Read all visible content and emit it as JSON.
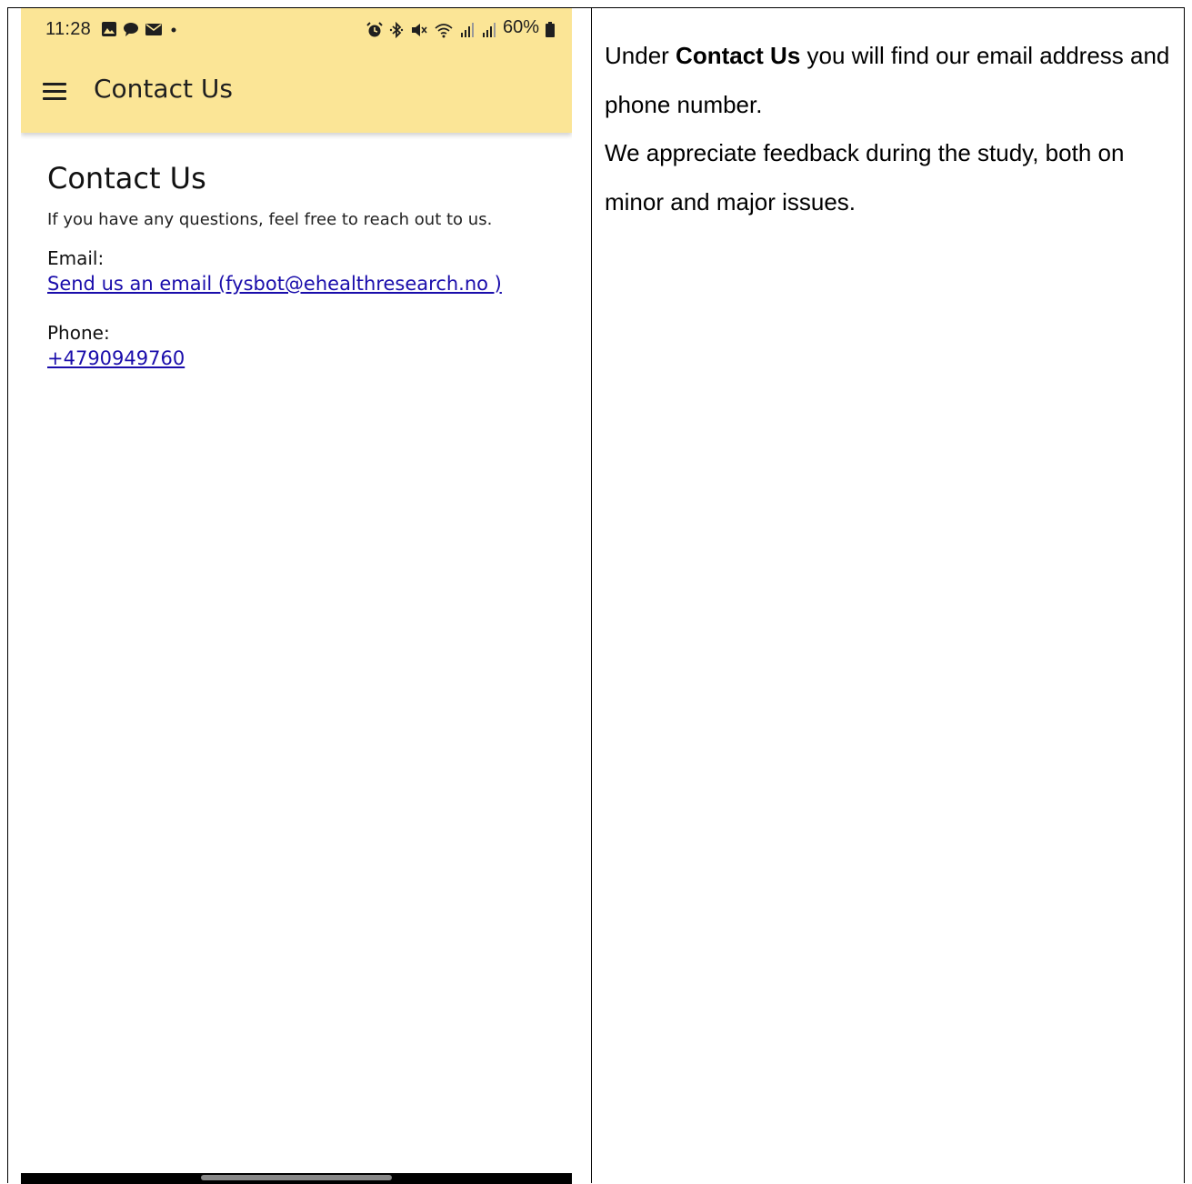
{
  "status_bar": {
    "time": "11:28",
    "battery": "60%",
    "left_icons": [
      "gallery-icon",
      "chat-icon",
      "mail-icon",
      "dot-icon"
    ],
    "right_icons": [
      "alarm-icon",
      "bluetooth-icon",
      "mute-icon",
      "wifi-icon",
      "signal-icon",
      "signal-icon",
      "battery-icon"
    ]
  },
  "appbar": {
    "title": "Contact Us",
    "background": "#fbe596"
  },
  "page": {
    "title": "Contact Us",
    "intro": "If you have any questions, feel free to reach out to us.",
    "email_label": "Email:",
    "email_link": "Send us an email (fysbot@ehealthresearch.no )",
    "phone_label": "Phone:",
    "phone_link": "+4790949760",
    "link_color": "#1a0dab"
  },
  "description": {
    "p1_before": "Under ",
    "p1_bold": "Contact Us",
    "p1_after": " you will find our email address and phone number.",
    "p2": "We appreciate feedback during the study, both on minor and major issues."
  }
}
